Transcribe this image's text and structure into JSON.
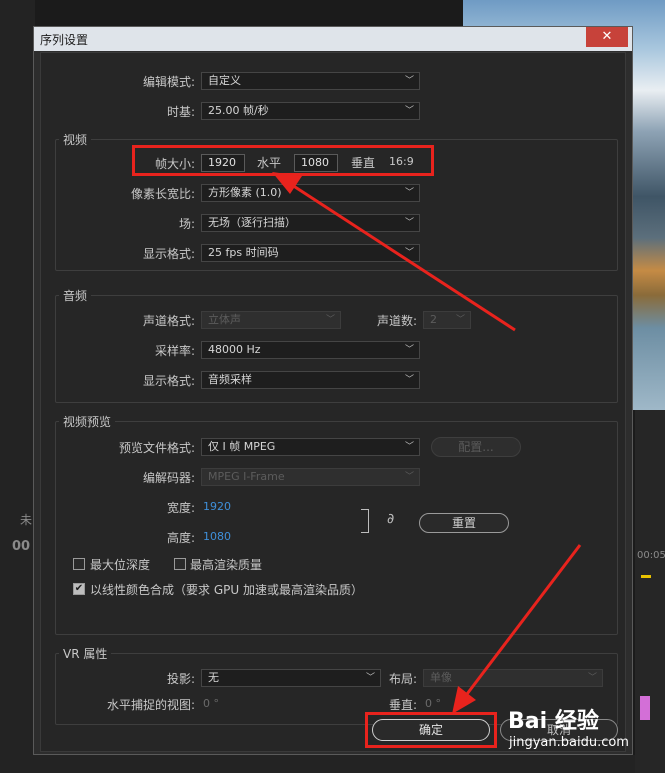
{
  "dialog": {
    "title": "序列设置",
    "close_glyph": "✕"
  },
  "general": {
    "edit_mode_label": "编辑模式:",
    "edit_mode_value": "自定义",
    "timebase_label": "时基:",
    "timebase_value": "25.00  帧/秒"
  },
  "video": {
    "section_title": "视频",
    "frame_size_label": "帧大小:",
    "frame_width": "1920",
    "horizontal_label": "水平",
    "frame_height": "1080",
    "vertical_label": "垂直",
    "aspect": "16:9",
    "pixel_aspect_label": "像素长宽比:",
    "pixel_aspect_value": "方形像素 (1.0)",
    "fields_label": "场:",
    "fields_value": "无场（逐行扫描）",
    "display_format_label": "显示格式:",
    "display_format_value": "25 fps 时间码"
  },
  "audio": {
    "section_title": "音频",
    "channel_format_label": "声道格式:",
    "channel_format_value": "立体声",
    "channels_label": "声道数:",
    "channels_value": "2",
    "sample_rate_label": "采样率:",
    "sample_rate_value": "48000 Hz",
    "display_format_label": "显示格式:",
    "display_format_value": "音频采样"
  },
  "preview": {
    "section_title": "视频预览",
    "file_format_label": "预览文件格式:",
    "file_format_value": "仅 I 帧 MPEG",
    "configure_label": "配置...",
    "codec_label": "编解码器:",
    "codec_value": "MPEG I-Frame",
    "width_label": "宽度:",
    "width_value": "1920",
    "height_label": "高度:",
    "height_value": "1080",
    "reset_label": "重置",
    "max_bit_depth_label": "最大位深度",
    "max_render_quality_label": "最高渲染质量",
    "linear_color_label": "以线性颜色合成（要求 GPU 加速或最高渲染品质）"
  },
  "vr": {
    "section_title": "VR 属性",
    "projection_label": "投影:",
    "projection_value": "无",
    "layout_label": "布局:",
    "layout_value": "单像",
    "h_view_label": "水平捕捉的视图:",
    "h_view_value": "0 °",
    "v_label": "垂直:",
    "v_value": "0 °"
  },
  "footer": {
    "ok_label": "确定",
    "cancel_label": "取消"
  },
  "background": {
    "left_text_1": "00",
    "right_text_1": "00:05",
    "tab_text": "未"
  },
  "watermark": {
    "brand": "Bai 经验",
    "url": "jingyan.baidu.com"
  },
  "colors": {
    "annotation_red": "#e8231d",
    "link_blue": "#3f8fd9",
    "close_red": "#c7423a"
  }
}
